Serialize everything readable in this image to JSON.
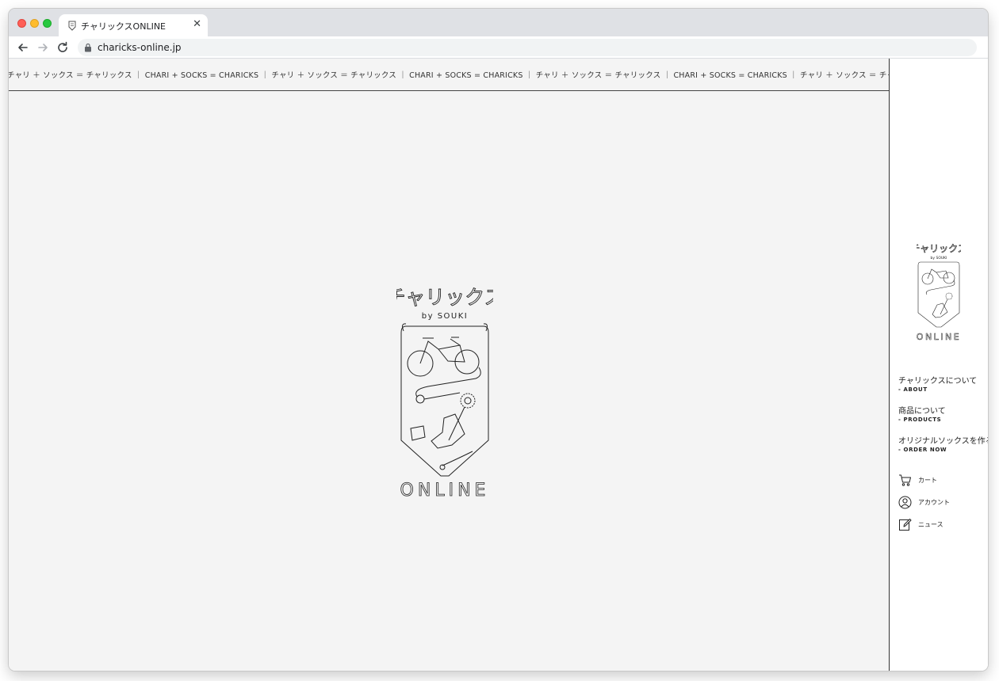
{
  "browser": {
    "tab_title": "チャリックスONLINE",
    "close_glyph": "✕",
    "url": "charicks-online.jp"
  },
  "ticker": {
    "text": "チャリ ＋ ソックス ＝ チャリックス ｜ CHARI + SOCKS = CHARICKS ｜ チャリ ＋ ソックス ＝ チャリックス ｜ CHARI + SOCKS = CHARICKS ｜ チャリ ＋ ソックス ＝ チャリックス ｜ CHARI + SOCKS = CHARICKS ｜ チャリ ＋ ソックス ＝ チャリックス ｜ CHARI + SOCKS = CHARICKS"
  },
  "logo": {
    "title": "チャリックス",
    "byline": "by SOUKI",
    "bottom": "ONLINE"
  },
  "sidebar": {
    "logo": {
      "title": "チャリックス",
      "byline": "by SOUKI",
      "bottom": "ONLINE"
    },
    "menu": [
      {
        "ja": "チャリックスについて",
        "en": "- ABOUT"
      },
      {
        "ja": "商品について",
        "en": "- PRODUCTS"
      },
      {
        "ja": "オリジナルソックスを作る",
        "en": "- ORDER NOW"
      }
    ],
    "utils": [
      {
        "label": "カート",
        "icon": "cart-icon"
      },
      {
        "label": "アカウント",
        "icon": "account-icon"
      },
      {
        "label": "ニュース",
        "icon": "news-icon"
      }
    ]
  },
  "colors": {
    "background": "#f4f4f4",
    "sidebar": "#ffffff",
    "line": "#333333"
  }
}
